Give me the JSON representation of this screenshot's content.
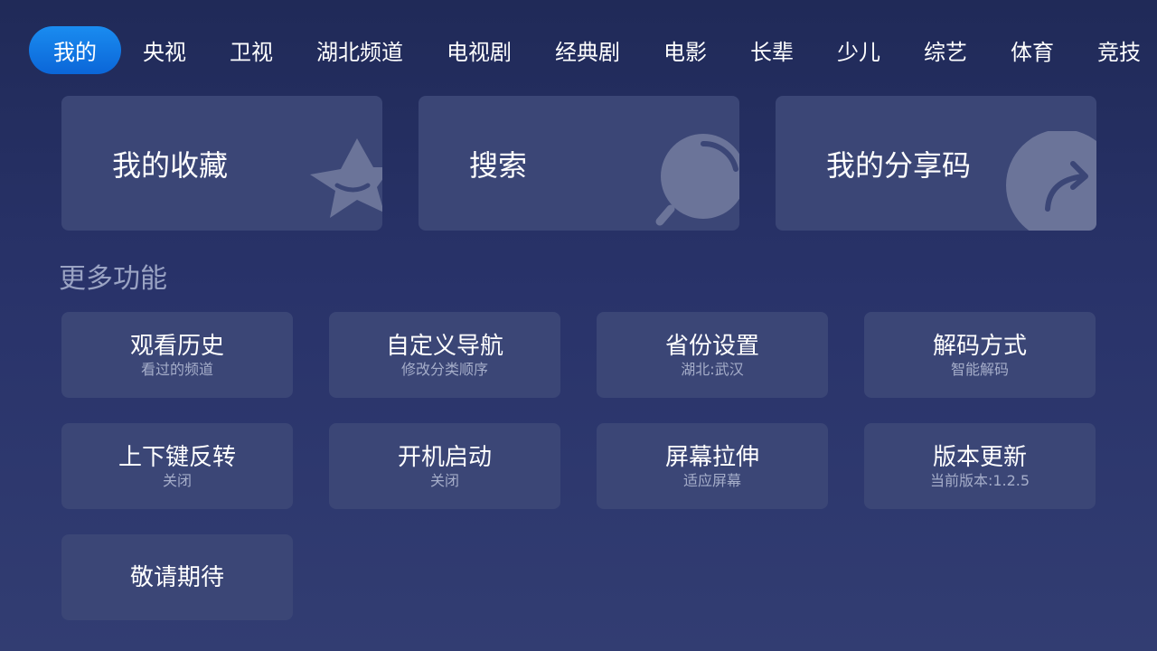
{
  "tabs": [
    {
      "label": "我的",
      "active": true
    },
    {
      "label": "央视"
    },
    {
      "label": "卫视"
    },
    {
      "label": "湖北频道"
    },
    {
      "label": "电视剧"
    },
    {
      "label": "经典剧"
    },
    {
      "label": "电影"
    },
    {
      "label": "长辈"
    },
    {
      "label": "少儿"
    },
    {
      "label": "综艺"
    },
    {
      "label": "体育"
    },
    {
      "label": "竞技"
    }
  ],
  "cards": {
    "favorites": {
      "label": "我的收藏",
      "icon": "star-icon"
    },
    "search": {
      "label": "搜索",
      "icon": "search-icon"
    },
    "share": {
      "label": "我的分享码",
      "icon": "share-arrow-icon"
    }
  },
  "more": {
    "title": "更多功能",
    "tiles": [
      {
        "title": "观看历史",
        "sub": "看过的频道"
      },
      {
        "title": "自定义导航",
        "sub": "修改分类顺序"
      },
      {
        "title": "省份设置",
        "sub": "湖北:武汉"
      },
      {
        "title": "解码方式",
        "sub": "智能解码"
      },
      {
        "title": "上下键反转",
        "sub": "关闭"
      },
      {
        "title": "开机启动",
        "sub": "关闭"
      },
      {
        "title": "屏幕拉伸",
        "sub": "适应屏幕"
      },
      {
        "title": "版本更新",
        "sub": "当前版本:1.2.5"
      },
      {
        "title": "敬请期待",
        "sub": ""
      }
    ]
  },
  "colors": {
    "accent": "#0b78e6",
    "card": "#3b4676",
    "background": "#29336a"
  }
}
